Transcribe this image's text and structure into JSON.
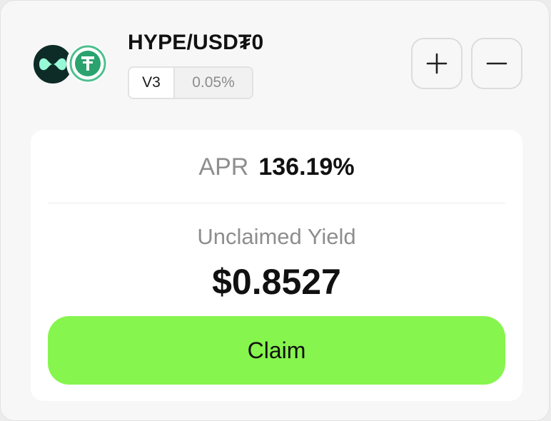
{
  "pair": {
    "title": "HYPE/USD₮0",
    "version": "V3",
    "fee": "0.05%"
  },
  "tokens": [
    {
      "name": "HYPE",
      "icon": "hype-logo-icon",
      "bg_color": "#0d2b27",
      "mark_color": "#97f9d6"
    },
    {
      "name": "USD₮0",
      "icon": "usdt0-logo-icon",
      "ring_color": "#4fbf8f",
      "mark_color": "#2aa36f"
    }
  ],
  "actions": {
    "add_icon": "plus-icon",
    "remove_icon": "minus-icon"
  },
  "stats": {
    "apr_label": "APR",
    "apr_value": "136.19%",
    "yield_label": "Unclaimed Yield",
    "yield_value": "$0.8527"
  },
  "claim": {
    "label": "Claim",
    "color": "#86f54e"
  }
}
